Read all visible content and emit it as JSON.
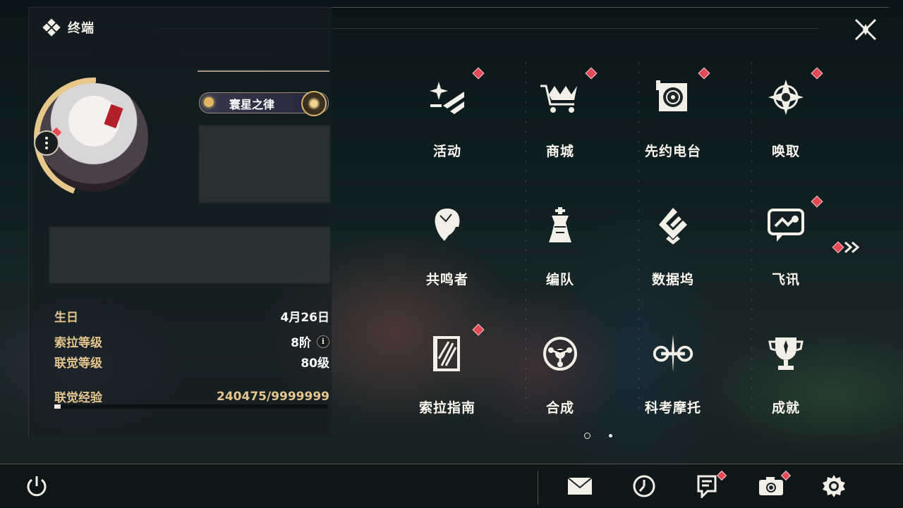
{
  "header": {
    "title": "终端"
  },
  "profile": {
    "title_badge": "寰星之律",
    "stats": {
      "birthday_label": "生日",
      "birthday_value": "4月26日",
      "sola_label": "索拉等级",
      "sola_value": "8阶",
      "union_label": "联觉等级",
      "union_value": "80级",
      "exp_label": "联觉经验",
      "exp_value": "240475/9999999",
      "exp_progress": 0.024
    }
  },
  "menu": [
    {
      "label": "活动",
      "icon": "sparkle-icon",
      "badge": true
    },
    {
      "label": "商城",
      "icon": "shop-cart-icon",
      "badge": true
    },
    {
      "label": "先约电台",
      "icon": "radio-icon",
      "badge": true
    },
    {
      "label": "唤取",
      "icon": "compass-star-icon",
      "badge": true
    },
    {
      "label": "共鸣者",
      "icon": "character-icon",
      "badge": false
    },
    {
      "label": "编队",
      "icon": "chess-icon",
      "badge": false
    },
    {
      "label": "数据坞",
      "icon": "data-dock-icon",
      "badge": false
    },
    {
      "label": "飞讯",
      "icon": "chat-icon",
      "badge": true
    },
    {
      "label": "索拉指南",
      "icon": "guide-book-icon",
      "badge": true
    },
    {
      "label": "合成",
      "icon": "synthesis-icon",
      "badge": false
    },
    {
      "label": "科考摩托",
      "icon": "motorbike-icon",
      "badge": false
    },
    {
      "label": "成就",
      "icon": "trophy-icon",
      "badge": false
    }
  ],
  "colors": {
    "accent_gold": "#e3c68d",
    "badge_red": "#e44a55"
  }
}
